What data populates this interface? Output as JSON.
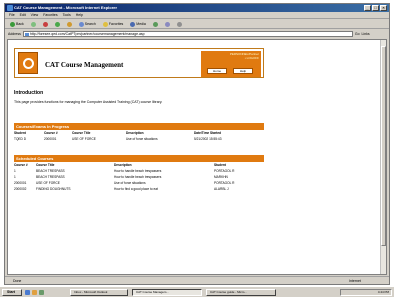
{
  "window": {
    "title": "CAT Course Management - Microsoft Internet Explorer"
  },
  "menu": [
    "File",
    "Edit",
    "View",
    "Favorites",
    "Tools",
    "Help"
  ],
  "toolbar": {
    "back": "Back",
    "search": "Search",
    "favorites": "Favorites",
    "media": "Media"
  },
  "address": {
    "label": "Address",
    "value": "http://foresee.qed.com/CatPTpm/partner/coursemanagement/manage.asp",
    "go": "Go",
    "links": "Links"
  },
  "header": {
    "title": "CAT Course Management",
    "user_line1": "PERSONNEL/Partner",
    "user_line2": "• LOGOFF",
    "home": "Home",
    "help": "Help"
  },
  "intro": {
    "heading": "Introduction",
    "text": "This page provides functions for managing the Computer Assisted Training (CAT) course library."
  },
  "in_progress": {
    "heading": "Courses/Exams In Progress",
    "columns": [
      "Student",
      "Course #",
      "Course Title",
      "Description",
      "Date/Time Started"
    ],
    "rows": [
      [
        "TQED D",
        "2000001",
        "USE OF FORCE",
        "Use of force situations",
        "5/21/2002 15:55:43"
      ]
    ]
  },
  "scheduled": {
    "heading": "Scheduled Courses",
    "columns": [
      "Course #",
      "Course Title",
      "Description",
      "Student"
    ],
    "rows": [
      [
        "1",
        "BEACH TRESPASS",
        "How to handle beach trespassers",
        "PORTAGOL R"
      ],
      [
        "1",
        "BEACH TRESPASS",
        "How to handle beach trespassers",
        "MARKHN"
      ],
      [
        "2000001",
        "USE OF FORCE",
        "Use of force situations",
        "PORTAGOL R"
      ],
      [
        "2000002",
        "FINDING DOUGHNUTS",
        "How to find a good place to eat",
        "ALARBL J"
      ]
    ]
  },
  "status": {
    "left": "Done",
    "zone": "Internet"
  },
  "taskbar": {
    "start": "Start",
    "tasks": [
      "Inbox - Microsoft Outlook",
      "CAT Course Managem...",
      "CAT Course guide - Micro..."
    ],
    "clock": "4:44 PM"
  }
}
